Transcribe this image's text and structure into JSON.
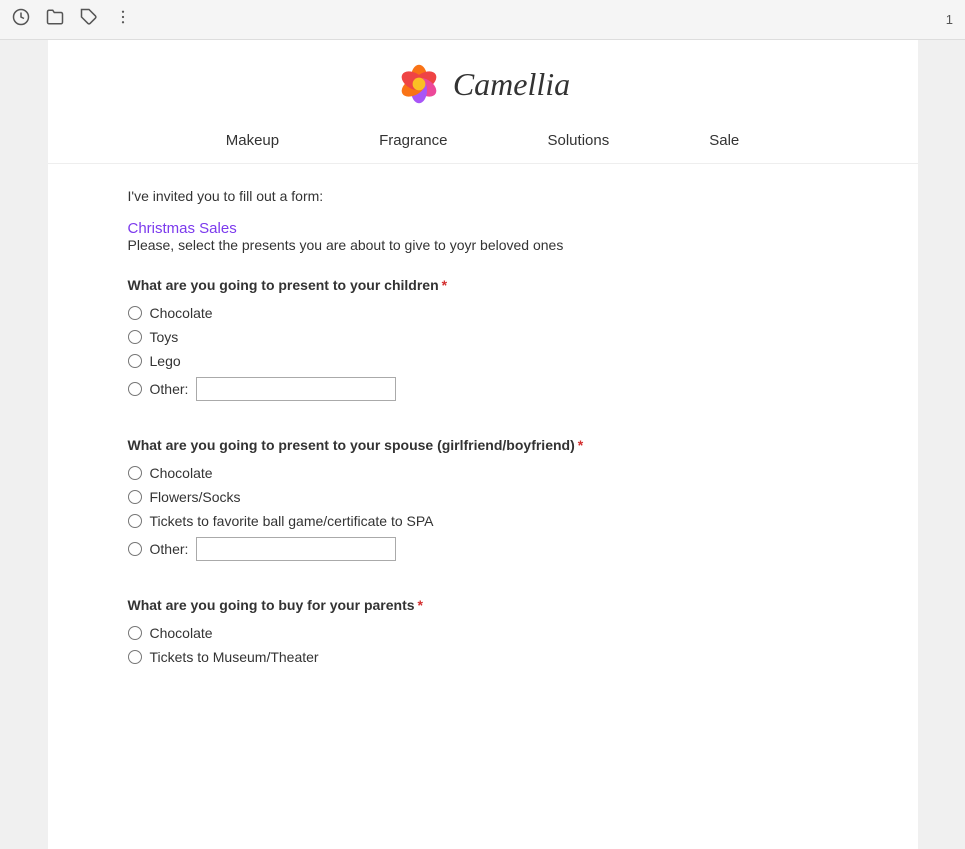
{
  "topbar": {
    "page_number": "1"
  },
  "header": {
    "logo_text": "Camellia",
    "nav_items": [
      "Makeup",
      "Fragrance",
      "Solutions",
      "Sale"
    ]
  },
  "form": {
    "invite_text": "I've invited you to fill out a form:",
    "form_title": "Christmas Sales",
    "description": "Please, select the presents you are about to give to yoyr beloved ones",
    "questions": [
      {
        "id": "children",
        "label": "What are you going to present to your children",
        "required": true,
        "options": [
          "Chocolate",
          "Toys",
          "Lego"
        ],
        "has_other": true,
        "other_label": "Other:"
      },
      {
        "id": "spouse",
        "label": "What are you going to present to your spouse (girlfriend/boyfriend)",
        "required": true,
        "options": [
          "Chocolate",
          "Flowers/Socks",
          "Tickets to favorite ball game/certificate to SPA"
        ],
        "has_other": true,
        "other_label": "Other:"
      },
      {
        "id": "parents",
        "label": "What are you going to buy for your parents",
        "required": true,
        "options": [
          "Chocolate",
          "Tickets to Museum/Theater"
        ],
        "has_other": false
      }
    ]
  }
}
